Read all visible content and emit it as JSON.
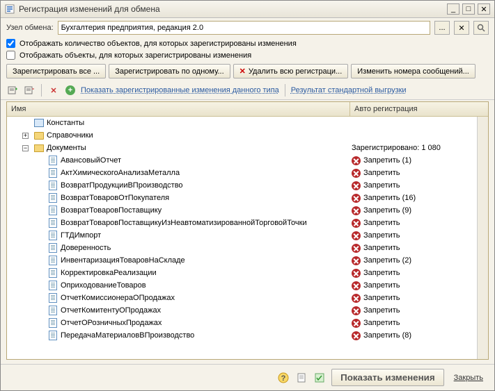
{
  "window": {
    "title": "Регистрация изменений для обмена"
  },
  "exchange": {
    "label": "Узел обмена:",
    "value": "Бухгалтерия предприятия, редакция 2.0"
  },
  "checks": {
    "showCount": "Отображать количество объектов, для которых зарегистрированы изменения",
    "showObjects": "Отображать объекты, для которых зарегистрированы изменения"
  },
  "buttons": {
    "regAll": "Зарегистрировать все ...",
    "regOne": "Зарегистрировать по одному...",
    "delReg": "Удалить всю регистраци...",
    "changeNum": "Изменить номера сообщений..."
  },
  "toolbar2": {
    "showReg": "Показать зарегистрированные изменения данного типа",
    "stdResult": "Результат стандартной выгрузки"
  },
  "cols": {
    "name": "Имя",
    "reg": "Авто регистрация"
  },
  "tree": {
    "constants": "Константы",
    "refs": "Справочники",
    "docs": "Документы",
    "docsReg": "Зарегистрировано: 1 080",
    "items": [
      {
        "name": "АвансовыйОтчет",
        "reg": "Запретить (1)"
      },
      {
        "name": "АктХимическогоАнализаМеталла",
        "reg": "Запретить"
      },
      {
        "name": "ВозвратПродукцииВПроизводство",
        "reg": "Запретить"
      },
      {
        "name": "ВозвратТоваровОтПокупателя",
        "reg": "Запретить (16)"
      },
      {
        "name": "ВозвратТоваровПоставщику",
        "reg": "Запретить (9)"
      },
      {
        "name": "ВозвратТоваровПоставщикуИзНеавтоматизированнойТорговойТочки",
        "reg": "Запретить"
      },
      {
        "name": "ГТДИмпорт",
        "reg": "Запретить"
      },
      {
        "name": "Доверенность",
        "reg": "Запретить"
      },
      {
        "name": "ИнвентаризацияТоваровНаСкладе",
        "reg": "Запретить (2)"
      },
      {
        "name": "КорректировкаРеализации",
        "reg": "Запретить"
      },
      {
        "name": "ОприходованиеТоваров",
        "reg": "Запретить"
      },
      {
        "name": "ОтчетКомиссионераОПродажах",
        "reg": "Запретить"
      },
      {
        "name": "ОтчетКомитентуОПродажах",
        "reg": "Запретить"
      },
      {
        "name": "ОтчетОРозничныхПродажах",
        "reg": "Запретить"
      },
      {
        "name": "ПередачаМатериаловВПроизводство",
        "reg": "Запретить (8)"
      }
    ]
  },
  "footer": {
    "show": "Показать изменения",
    "close": "Закрыть"
  }
}
